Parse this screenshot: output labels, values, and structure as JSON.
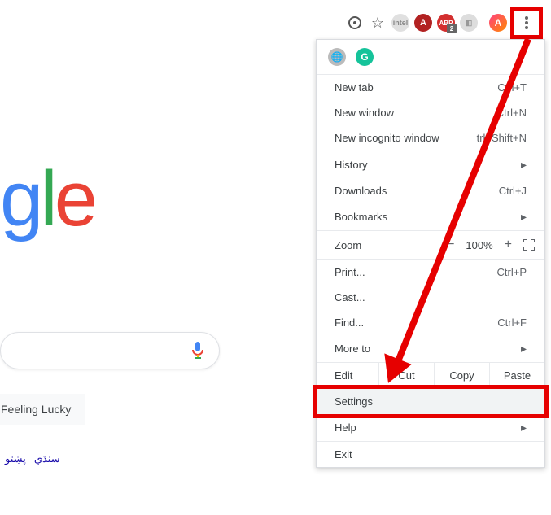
{
  "toolbar": {
    "ext_intel": "intel",
    "ext_a": "A",
    "ext_abp": "ABP",
    "ext_abp_count": "2",
    "avatar_letter": "A"
  },
  "menu": {
    "new_tab": {
      "label": "New tab",
      "shortcut": "Ctrl+T"
    },
    "new_window": {
      "label": "New window",
      "shortcut": "Ctrl+N"
    },
    "incognito": {
      "label": "New incognito window",
      "shortcut": "trl+Shift+N"
    },
    "history": {
      "label": "History"
    },
    "downloads": {
      "label": "Downloads",
      "shortcut": "Ctrl+J"
    },
    "bookmarks": {
      "label": "Bookmarks"
    },
    "zoom": {
      "label": "Zoom",
      "minus": "−",
      "value": "100%",
      "plus": "+"
    },
    "print": {
      "label": "Print...",
      "shortcut": "Ctrl+P"
    },
    "cast": {
      "label": "Cast..."
    },
    "find": {
      "label": "Find...",
      "shortcut": "Ctrl+F"
    },
    "more_tools": {
      "label": "More to"
    },
    "edit": {
      "label": "Edit",
      "cut": "Cut",
      "copy": "Copy",
      "paste": "Paste"
    },
    "settings": {
      "label": "Settings"
    },
    "help": {
      "label": "Help"
    },
    "exit": {
      "label": "Exit"
    }
  },
  "page": {
    "logo_g": "g",
    "logo_l": "l",
    "logo_e": "e",
    "lucky": "Feeling Lucky",
    "lang1": "پښتو",
    "lang2": "سنڌي"
  },
  "annotation": {
    "highlight_color": "#e60000"
  }
}
